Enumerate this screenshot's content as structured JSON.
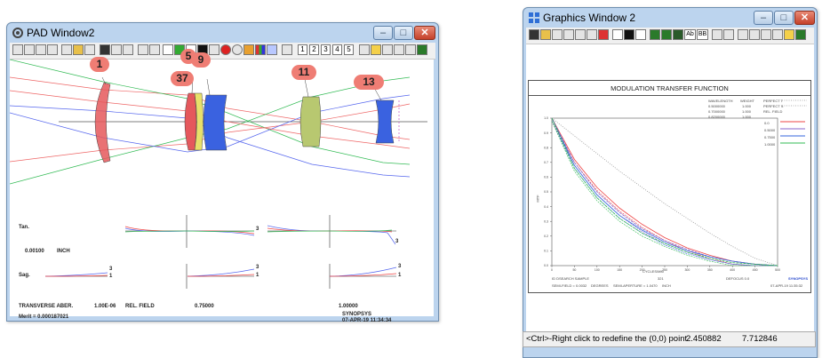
{
  "pad": {
    "title": "PAD Window2",
    "controls": {
      "min": "–",
      "max": "□",
      "close": "✕"
    },
    "toolbar_numbers": [
      "1",
      "2",
      "3",
      "4",
      "5"
    ],
    "surface_labels": [
      "1",
      "5",
      "37",
      "9",
      "11",
      "13"
    ],
    "labels": {
      "tan": "Tan.",
      "units_value": "0.00100",
      "units": "INCH",
      "sag": "Sag.",
      "transverse": "TRANSVERSE ABER.",
      "scale": "1.00E-06",
      "rel_field": "REL. FIELD",
      "field_mid": "0.75000",
      "field_full": "1.00000",
      "merit": "Merit = 0.000187021",
      "brand": "SYNOPSYS",
      "datetime": "07-APR-19 11:34:34"
    },
    "curve_labels": {
      "tan3": "3",
      "sag2_3": "3",
      "sag2_1": "1",
      "sag3_3": "3",
      "sag3_1": "1",
      "sag1_3": "3",
      "sag1_1": "1",
      "tan3b": "3"
    }
  },
  "graphics": {
    "title": "Graphics Window 2",
    "controls": {
      "min": "–",
      "max": "□",
      "close": "✕"
    },
    "toolbar_text_buttons": [
      "Ab",
      "BB"
    ],
    "chart_title": "MODULATION TRANSFER FUNCTION",
    "legend_header": [
      "WAVELENGTH",
      "WEIGHT"
    ],
    "legend_rows": [
      [
        "0.5000000",
        "1.000"
      ],
      [
        "0.7000000",
        "1.000"
      ],
      [
        "0.8200000",
        "1.000"
      ]
    ],
    "perfect_labels": [
      "PERFECT T",
      "PERFECT S",
      "REL. FIELD"
    ],
    "field_values": [
      "0.0",
      "0.5000",
      "0.7500",
      "1.0000"
    ],
    "ylabel": "MTF",
    "xlabel": "CYCLES/MM",
    "y_ticks": [
      "1.0",
      "0.9",
      "0.8",
      "0.7",
      "0.6",
      "0.5",
      "0.4",
      "0.3",
      "0.2",
      "0.1",
      "0.0"
    ],
    "x_ticks": [
      "0",
      "50",
      "100",
      "150",
      "200",
      "250",
      "300",
      "350",
      "400",
      "450",
      "500"
    ],
    "footer_left": "ID DSEARCH SAMPLE",
    "footer_mid": "321",
    "footer_defocus": "DEFOCUS    0.0",
    "footer_row2": [
      "SEMI-FIELD = 0.0032",
      "DEGREES",
      "SEMI-APERTURE = 1.0470",
      "INCH"
    ],
    "brand": "SYNOPSYS",
    "datetime": "07-APR-19 11:35:32",
    "status_text": "<Ctrl>-Right click to redefine the (0,0) point",
    "status_x": "2.450882",
    "status_y": "7.712846"
  },
  "chart_data": {
    "type": "line",
    "title": "MODULATION TRANSFER FUNCTION",
    "xlabel": "CYCLES/MM",
    "ylabel": "MTF",
    "xlim": [
      0,
      500
    ],
    "ylim": [
      0,
      1
    ],
    "x": [
      0,
      50,
      100,
      150,
      200,
      250,
      300,
      350,
      400,
      450,
      500
    ],
    "series": [
      {
        "name": "PERFECT T",
        "color": "#9a9a9a",
        "values": [
          1.0,
          0.88,
          0.76,
          0.64,
          0.53,
          0.42,
          0.32,
          0.22,
          0.13,
          0.05,
          0.0
        ]
      },
      {
        "name": "0.0",
        "color": "#ee4444",
        "values": [
          1.0,
          0.72,
          0.53,
          0.39,
          0.28,
          0.19,
          0.12,
          0.07,
          0.03,
          0.01,
          0.0
        ]
      },
      {
        "name": "0.5000",
        "color": "#8866cc",
        "values": [
          1.0,
          0.7,
          0.5,
          0.36,
          0.25,
          0.17,
          0.11,
          0.06,
          0.03,
          0.01,
          0.0
        ]
      },
      {
        "name": "0.7500",
        "color": "#3366dd",
        "values": [
          1.0,
          0.68,
          0.48,
          0.34,
          0.24,
          0.16,
          0.1,
          0.06,
          0.03,
          0.01,
          0.0
        ]
      },
      {
        "name": "1.0000",
        "color": "#33bb55",
        "values": [
          1.0,
          0.66,
          0.46,
          0.32,
          0.22,
          0.15,
          0.09,
          0.05,
          0.02,
          0.01,
          0.0
        ]
      }
    ]
  },
  "colors": {
    "title_bar": "#bcd4ee",
    "lens_red": "#e5585c",
    "lens_blue": "#3a62e0",
    "lens_green": "#b8c870",
    "badge": "#ef7d74"
  }
}
